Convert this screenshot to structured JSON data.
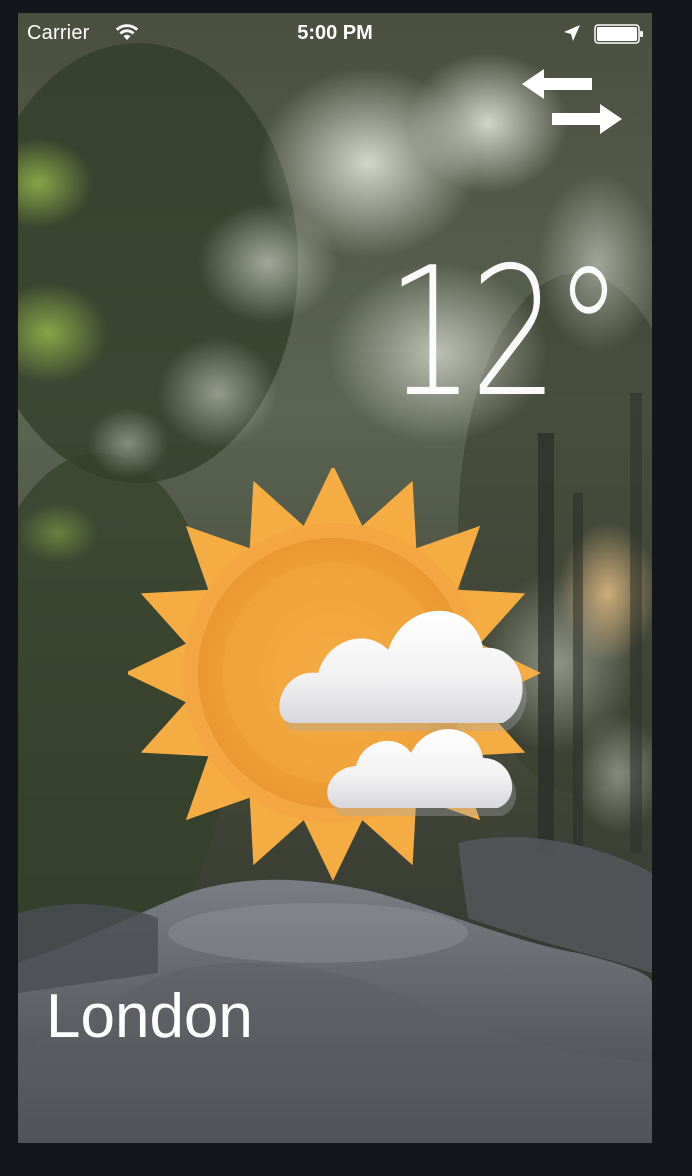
{
  "status_bar": {
    "carrier": "Carrier",
    "time": "5:00 PM",
    "wifi_icon": "wifi-icon",
    "location_icon": "location-arrow-icon",
    "battery_icon": "battery-icon"
  },
  "toolbar": {
    "swap_icon": "swap-arrows-icon"
  },
  "weather": {
    "temperature": "12°",
    "condition_icon": "partly-cloudy-sun-icon",
    "city": "London"
  },
  "colors": {
    "sun_orange": "#f2a53c",
    "text": "#ffffff",
    "frame": "#14161b"
  }
}
